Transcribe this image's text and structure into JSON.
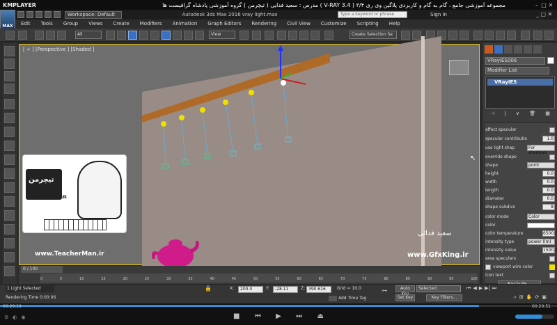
{
  "player": {
    "logo": "KMPLAYER",
    "video_title": "مجموعه آموزشی جامع ، گام به گام و کاربردی پلاگین وی ری ۳/۴   ( V-RAY 3.4 )   مدرس : سعید فدایی ( تیچرمن ) گروه آموزشی پادشاه گرافیست ها",
    "time_elapsed": "00:20:19",
    "time_total": "00:20:51",
    "progress": 0.86
  },
  "app": {
    "logo": "MAX",
    "workspace": "Workspace: Default",
    "title": "Autodesk 3ds Max 2016    vray light.max",
    "search_placeholder": "Type a keyword or phrase",
    "sign_in": "Sign In"
  },
  "menu": [
    "Edit",
    "Tools",
    "Group",
    "Views",
    "Create",
    "Modifiers",
    "Animation",
    "Graph Editors",
    "Rendering",
    "Civil View",
    "Customize",
    "Scripting",
    "Help"
  ],
  "toolbar": {
    "filter": "All",
    "ref_coord": "View",
    "selection_set": "Create Selection Se"
  },
  "viewport": {
    "label": "[ + ] [Perspective ] [Shaded ]"
  },
  "watermark": {
    "left_site": "www.TeacherMan.ir",
    "right_site": "www.GfxKing.ir",
    "signature": "سعید فدائی",
    "teacher_fa": "تیچرمن",
    "teacher_en": "Teacher Man"
  },
  "command_panel": {
    "object_name": "VRayIES006",
    "modifier_list": "Modifier List",
    "stack_item": "VRayIES",
    "params": [
      {
        "label": "affect specular",
        "type": "check"
      },
      {
        "label": "specular contributio",
        "type": "spin",
        "value": "1.0"
      },
      {
        "label": "use light shap",
        "type": "dd",
        "value": "For shadows"
      },
      {
        "label": "override shape",
        "type": "check"
      },
      {
        "label": "shape",
        "type": "dd",
        "value": "point"
      },
      {
        "label": "height",
        "type": "spin",
        "value": "0.0"
      },
      {
        "label": "width",
        "type": "spin",
        "value": "0.0"
      },
      {
        "label": "length",
        "type": "spin",
        "value": "0.0"
      },
      {
        "label": "diameter",
        "type": "spin",
        "value": "0.0"
      },
      {
        "label": "shape subdivs",
        "type": "spin",
        "value": "8"
      },
      {
        "label": "color mode",
        "type": "dd",
        "value": "Color"
      },
      {
        "label": "color",
        "type": "swatch"
      },
      {
        "label": "color temperature",
        "type": "spin",
        "value": "6500.0"
      },
      {
        "label": "intensity type",
        "type": "dd",
        "value": "power (lm)"
      },
      {
        "label": "intensity value",
        "type": "spin",
        "value": "1500.0"
      },
      {
        "label": "area speculars",
        "type": "check"
      },
      {
        "label": "viewport wire color",
        "type": "yswatch"
      },
      {
        "label": "icon text",
        "type": "check"
      }
    ],
    "exclude": "Exclude..."
  },
  "timeline": {
    "frame": "0 / 100",
    "ticks": [
      "0",
      "5",
      "10",
      "15",
      "20",
      "25",
      "30",
      "35",
      "40",
      "45",
      "50",
      "55",
      "60",
      "65",
      "70",
      "75",
      "80",
      "85",
      "90",
      "95",
      "100"
    ]
  },
  "status": {
    "selection": "1 Light Selected",
    "render_time": "Rendering Time  0:00:06",
    "x_label": "X:",
    "x": "200.0",
    "y_label": "Y:",
    "y": "-28.11",
    "z_label": "Z:",
    "z": "390.616",
    "grid": "Grid = 10.0",
    "add_time_tag": "Add Time Tag",
    "auto_key": "Auto Key",
    "selected": "Selected",
    "set_key": "Set Key",
    "key_filters": "Key Filters..."
  },
  "colors": {
    "viewport_border": "#f0c600",
    "beam": "#b06a28",
    "teapot": "#d01c8b",
    "wall": "#998c86"
  }
}
